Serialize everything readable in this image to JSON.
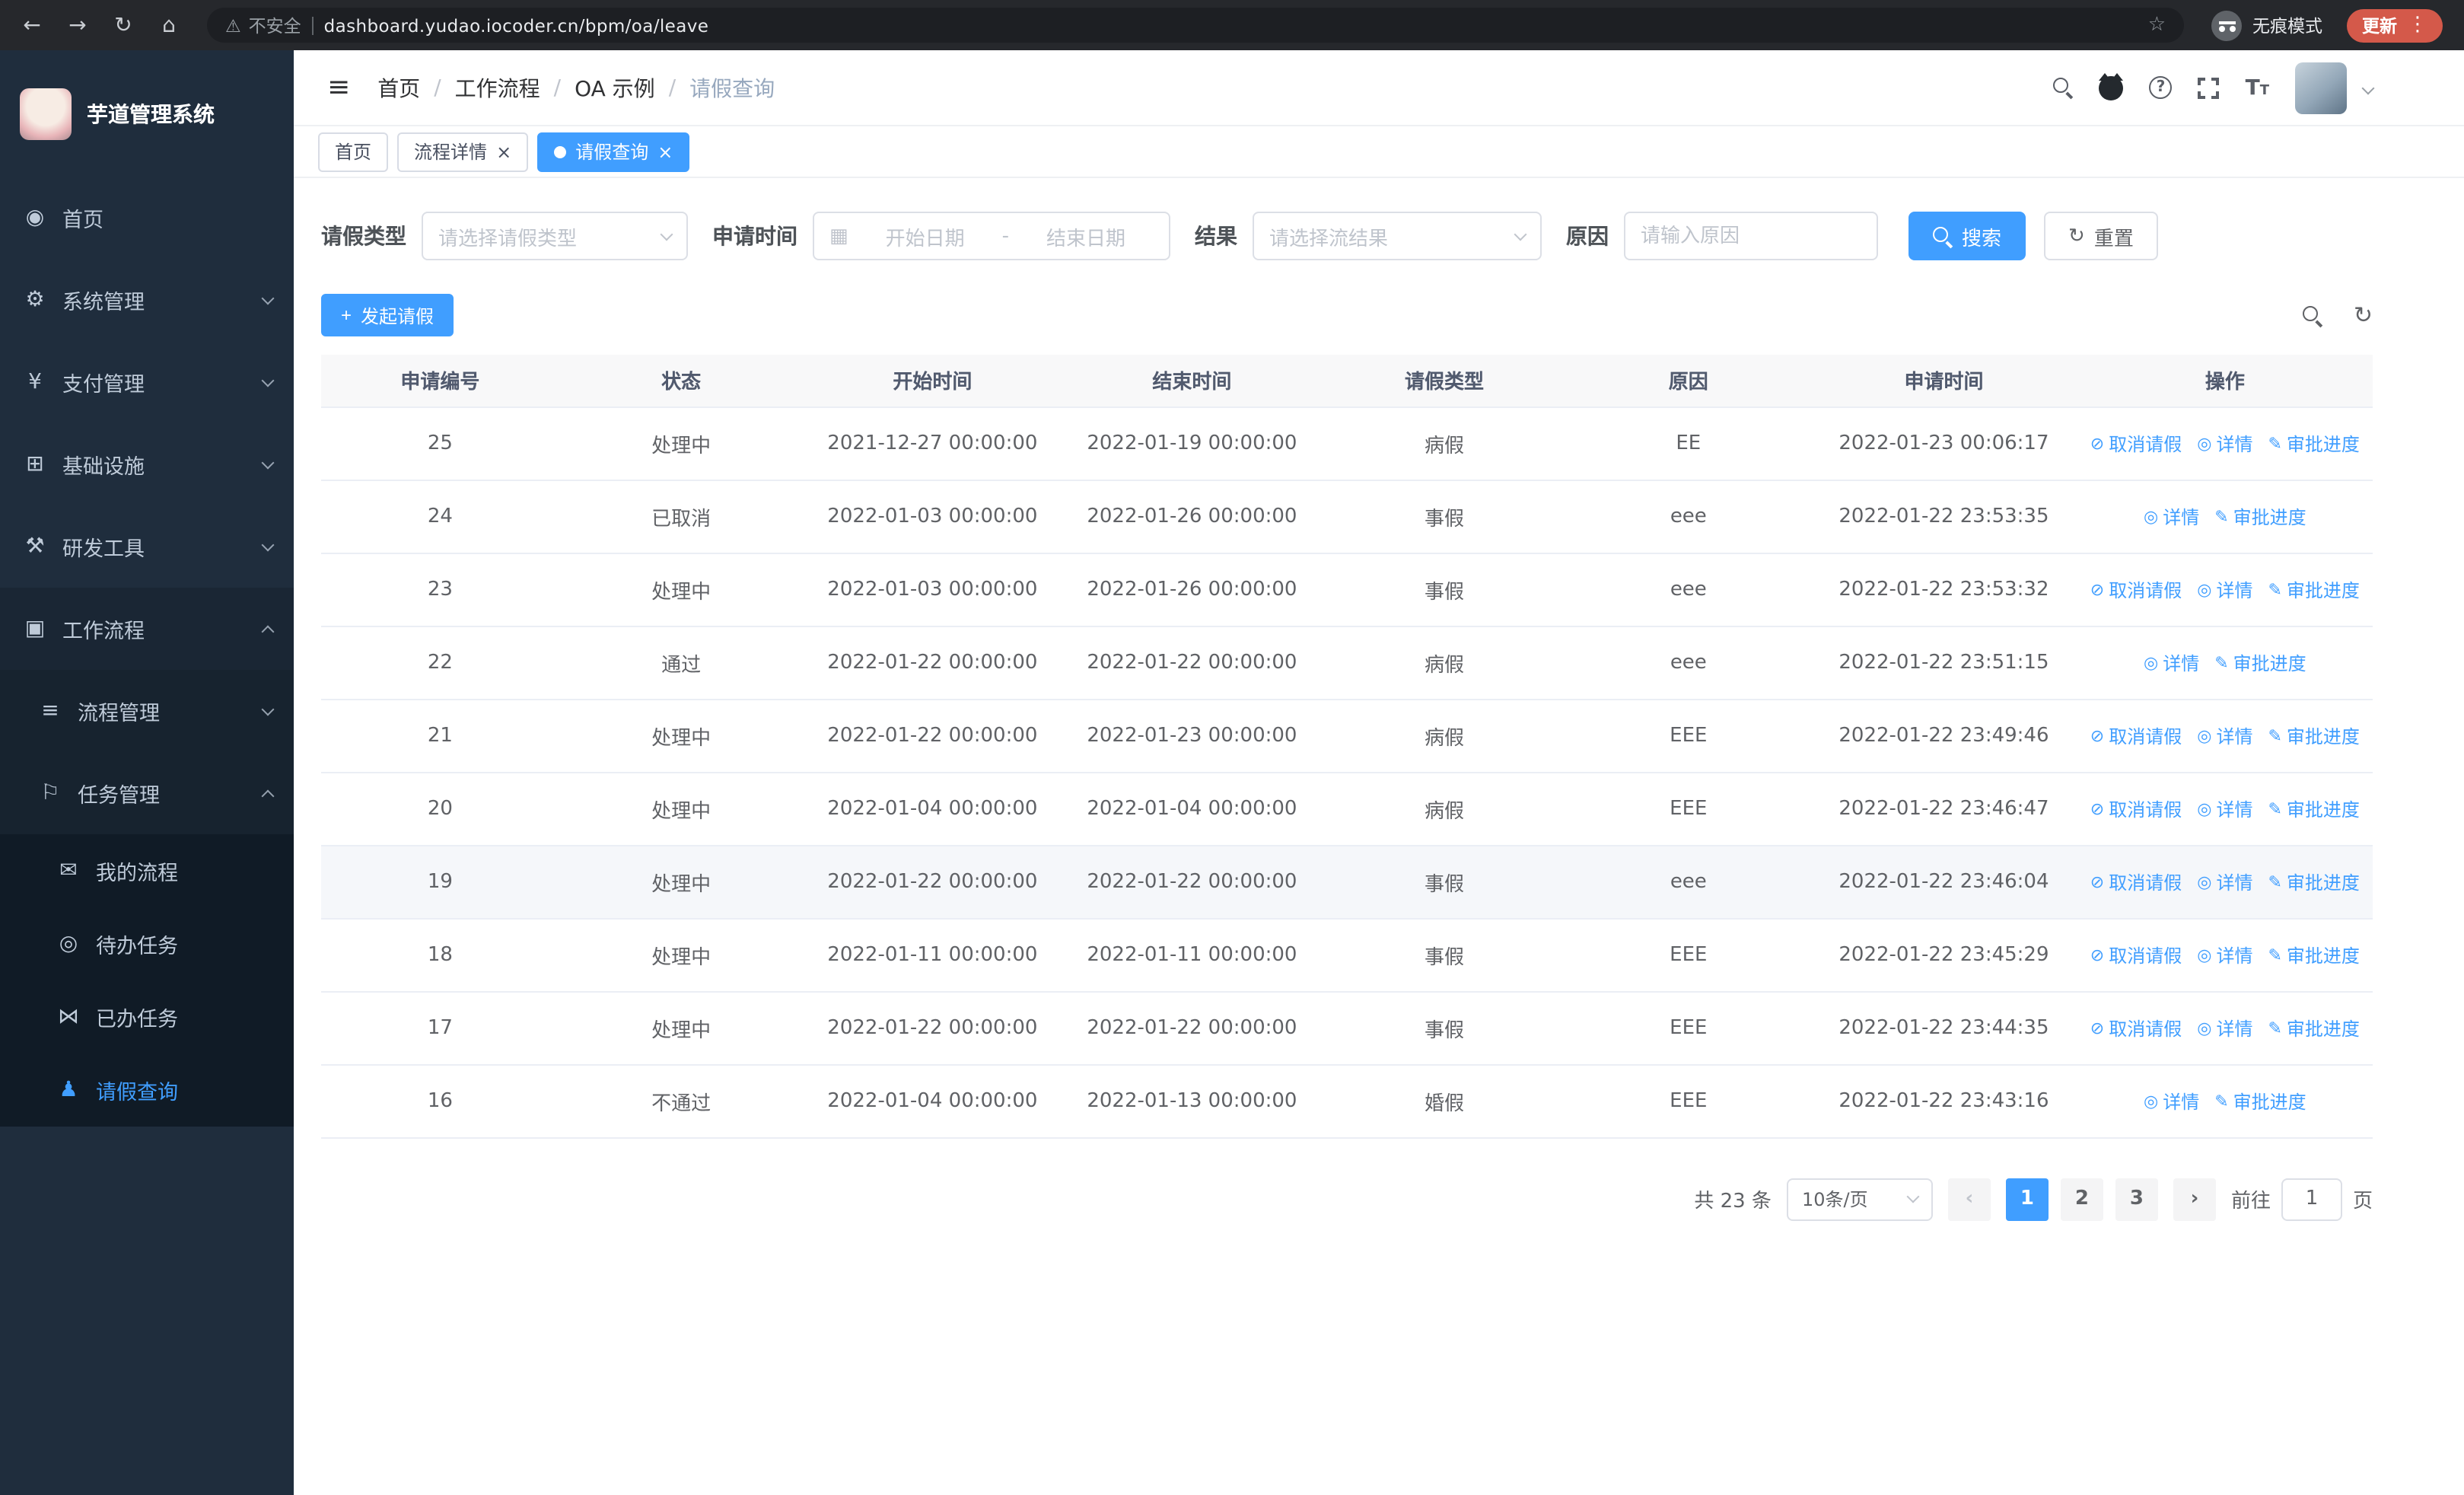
{
  "browser": {
    "security_label": "不安全",
    "url": "dashboard.yudao.iocoder.cn/bpm/oa/leave",
    "incognito_label": "无痕模式",
    "update_label": "更新"
  },
  "icons": {
    "back": "←",
    "forward": "→",
    "reload": "↻",
    "home": "⌂",
    "warning": "⚠",
    "star": "☆",
    "menu-dots": "⋮",
    "collapse": "≡",
    "dashboard": "◉",
    "gear": "⚙",
    "yen": "¥",
    "infra": "⊞",
    "tools": "⚒",
    "workflow": "▣",
    "process": "≡",
    "task": "⚐",
    "chat": "✉",
    "eye": "◎",
    "done": "⋈",
    "user": "♟",
    "plus": "+",
    "refresh": "↻",
    "calendar": "▦",
    "trash": "⊘",
    "edit": "✎",
    "prev": "‹",
    "next": "›",
    "question": "?",
    "font": "T",
    "close": "×"
  },
  "sidebar": {
    "logo_title": "芋道管理系统",
    "menu": [
      {
        "key": "home",
        "label": "首页",
        "icon": "dashboard",
        "level": 1
      },
      {
        "key": "system",
        "label": "系统管理",
        "icon": "gear",
        "level": 1,
        "chevron": "down"
      },
      {
        "key": "payment",
        "label": "支付管理",
        "icon": "yen",
        "level": 1,
        "chevron": "down"
      },
      {
        "key": "infrastructure",
        "label": "基础设施",
        "icon": "infra",
        "level": 1,
        "chevron": "down"
      },
      {
        "key": "dev-tools",
        "label": "研发工具",
        "icon": "tools",
        "level": 1,
        "chevron": "down"
      },
      {
        "key": "workflow",
        "label": "工作流程",
        "icon": "workflow",
        "level": 1,
        "chevron": "up",
        "expanded": true
      },
      {
        "key": "process-mgmt",
        "label": "流程管理",
        "icon": "process",
        "level": 2,
        "chevron": "down"
      },
      {
        "key": "task-mgmt",
        "label": "任务管理",
        "icon": "task",
        "level": 2,
        "chevron": "up",
        "expanded": true
      },
      {
        "key": "my-process",
        "label": "我的流程",
        "icon": "chat",
        "level": 3
      },
      {
        "key": "todo-tasks",
        "label": "待办任务",
        "icon": "eye",
        "level": 3
      },
      {
        "key": "done-tasks",
        "label": "已办任务",
        "icon": "done",
        "level": 3
      },
      {
        "key": "leave-query",
        "label": "请假查询",
        "icon": "user",
        "level": 3,
        "active": true
      }
    ]
  },
  "header": {
    "breadcrumb": [
      "首页",
      "工作流程",
      "OA 示例",
      "请假查询"
    ]
  },
  "tabs": [
    {
      "key": "home",
      "label": "首页",
      "closable": false,
      "active": false
    },
    {
      "key": "process-detail",
      "label": "流程详情",
      "closable": true,
      "active": false
    },
    {
      "key": "leave-query",
      "label": "请假查询",
      "closable": true,
      "active": true
    }
  ],
  "filters": {
    "leave_type_label": "请假类型",
    "leave_type_placeholder": "请选择请假类型",
    "apply_time_label": "申请时间",
    "start_date_placeholder": "开始日期",
    "range_separator": "-",
    "end_date_placeholder": "结束日期",
    "result_label": "结果",
    "result_placeholder": "请选择流结果",
    "reason_label": "原因",
    "reason_placeholder": "请输入原因",
    "search_button": "搜索",
    "reset_button": "重置"
  },
  "toolbar": {
    "create_button": "发起请假"
  },
  "table": {
    "columns": [
      {
        "key": "id",
        "label": "申请编号"
      },
      {
        "key": "status",
        "label": "状态"
      },
      {
        "key": "start",
        "label": "开始时间"
      },
      {
        "key": "end",
        "label": "结束时间"
      },
      {
        "key": "type",
        "label": "请假类型"
      },
      {
        "key": "reason",
        "label": "原因"
      },
      {
        "key": "apply_time",
        "label": "申请时间"
      },
      {
        "key": "actions",
        "label": "操作"
      }
    ],
    "action_defs": {
      "cancel": {
        "label": "取消请假",
        "icon": "trash"
      },
      "detail": {
        "label": "详情",
        "icon": "eye"
      },
      "progress": {
        "label": "审批进度",
        "icon": "edit"
      }
    },
    "rows": [
      {
        "id": "25",
        "status": "处理中",
        "start": "2021-12-27 00:00:00",
        "end": "2022-01-19 00:00:00",
        "type": "病假",
        "reason": "EE",
        "apply_time": "2022-01-23 00:06:17",
        "actions": [
          "cancel",
          "detail",
          "progress"
        ]
      },
      {
        "id": "24",
        "status": "已取消",
        "start": "2022-01-03 00:00:00",
        "end": "2022-01-26 00:00:00",
        "type": "事假",
        "reason": "eee",
        "apply_time": "2022-01-22 23:53:35",
        "actions": [
          "detail",
          "progress"
        ]
      },
      {
        "id": "23",
        "status": "处理中",
        "start": "2022-01-03 00:00:00",
        "end": "2022-01-26 00:00:00",
        "type": "事假",
        "reason": "eee",
        "apply_time": "2022-01-22 23:53:32",
        "actions": [
          "cancel",
          "detail",
          "progress"
        ]
      },
      {
        "id": "22",
        "status": "通过",
        "start": "2022-01-22 00:00:00",
        "end": "2022-01-22 00:00:00",
        "type": "病假",
        "reason": "eee",
        "apply_time": "2022-01-22 23:51:15",
        "actions": [
          "detail",
          "progress"
        ]
      },
      {
        "id": "21",
        "status": "处理中",
        "start": "2022-01-22 00:00:00",
        "end": "2022-01-23 00:00:00",
        "type": "病假",
        "reason": "EEE",
        "apply_time": "2022-01-22 23:49:46",
        "actions": [
          "cancel",
          "detail",
          "progress"
        ]
      },
      {
        "id": "20",
        "status": "处理中",
        "start": "2022-01-04 00:00:00",
        "end": "2022-01-04 00:00:00",
        "type": "病假",
        "reason": "EEE",
        "apply_time": "2022-01-22 23:46:47",
        "actions": [
          "cancel",
          "detail",
          "progress"
        ]
      },
      {
        "id": "19",
        "status": "处理中",
        "start": "2022-01-22 00:00:00",
        "end": "2022-01-22 00:00:00",
        "type": "事假",
        "reason": "eee",
        "apply_time": "2022-01-22 23:46:04",
        "actions": [
          "cancel",
          "detail",
          "progress"
        ],
        "hover": true
      },
      {
        "id": "18",
        "status": "处理中",
        "start": "2022-01-11 00:00:00",
        "end": "2022-01-11 00:00:00",
        "type": "事假",
        "reason": "EEE",
        "apply_time": "2022-01-22 23:45:29",
        "actions": [
          "cancel",
          "detail",
          "progress"
        ]
      },
      {
        "id": "17",
        "status": "处理中",
        "start": "2022-01-22 00:00:00",
        "end": "2022-01-22 00:00:00",
        "type": "事假",
        "reason": "EEE",
        "apply_time": "2022-01-22 23:44:35",
        "actions": [
          "cancel",
          "detail",
          "progress"
        ]
      },
      {
        "id": "16",
        "status": "不通过",
        "start": "2022-01-04 00:00:00",
        "end": "2022-01-13 00:00:00",
        "type": "婚假",
        "reason": "EEE",
        "apply_time": "2022-01-22 23:43:16",
        "actions": [
          "detail",
          "progress"
        ]
      }
    ]
  },
  "pagination": {
    "total_text": "共 23 条",
    "page_size": "10条/页",
    "pages": [
      "1",
      "2",
      "3"
    ],
    "active_page": "1",
    "goto_label": "前往",
    "goto_value": "1",
    "goto_suffix": "页"
  },
  "colors": {
    "primary": "#409eff",
    "sidebar_bg": "#1f2d3d",
    "sidebar_submenu_bg": "#101b26",
    "update_pill_bg": "#d4594a",
    "table_header_bg": "#f8f8f9",
    "row_hover_bg": "#f5f7fa"
  }
}
